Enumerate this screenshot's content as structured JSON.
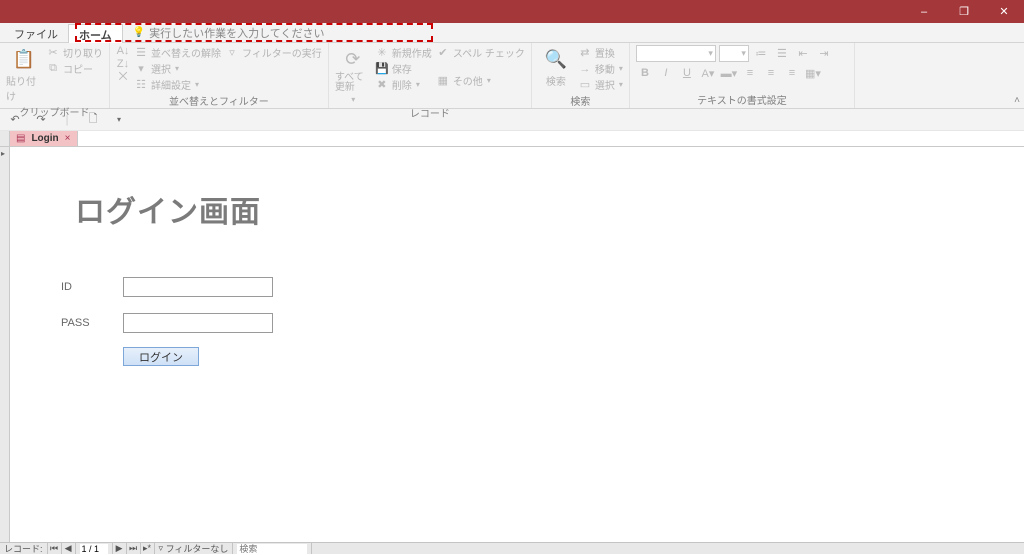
{
  "window": {
    "min": "–",
    "max": "❐",
    "close": "✕"
  },
  "tabs": {
    "file": "ファイル",
    "home": "ホーム",
    "tellme_placeholder": "実行したい作業を入力してください"
  },
  "ribbon": {
    "clipboard": {
      "paste": "貼り付け",
      "cut": "切り取り",
      "copy": "コピー",
      "label": "クリップボード"
    },
    "sortfilter": {
      "clear_sort": "並べ替えの解除",
      "selection": "選択",
      "adv_filter": "詳細設定",
      "toggle_filter": "フィルターの実行",
      "label": "並べ替えとフィルター"
    },
    "records": {
      "refresh": "すべて更新",
      "new": "新規作成",
      "save": "保存",
      "delete": "削除",
      "spelling": "スペル チェック",
      "more": "その他",
      "label": "レコード"
    },
    "find": {
      "find": "検索",
      "replace": "置換",
      "goto": "移動",
      "select": "選択",
      "label": "検索"
    },
    "textfmt": {
      "label": "テキストの書式設定",
      "bold": "B",
      "italic": "I",
      "underline": "U"
    }
  },
  "qat": {
    "undo": "↶",
    "redo": "↷"
  },
  "doc_tab": {
    "name": "Login"
  },
  "form": {
    "title": "ログイン画面",
    "id_label": "ID",
    "pass_label": "PASS",
    "login_btn": "ログイン"
  },
  "status": {
    "record_label": "レコード:",
    "position": "1 / 1",
    "no_filter": "フィルターなし",
    "search_placeholder": "検索"
  }
}
